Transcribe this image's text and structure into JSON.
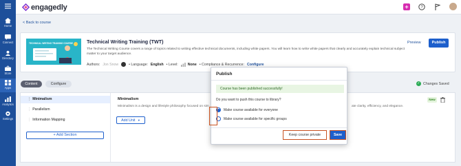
{
  "app": {
    "name": "engagedly",
    "brand_color": "#1d4f9a",
    "accent_color": "#1d5fcc"
  },
  "rail": {
    "items": [
      {
        "label": "Home",
        "icon": "home-icon"
      },
      {
        "label": "Connect",
        "icon": "connect-icon"
      },
      {
        "label": "Directory",
        "icon": "directory-icon"
      },
      {
        "label": "Store",
        "icon": "store-icon"
      },
      {
        "label": "Apps",
        "icon": "apps-icon"
      },
      {
        "label": "Analytics",
        "icon": "analytics-icon"
      },
      {
        "label": "Settings",
        "icon": "settings-icon"
      }
    ]
  },
  "nav": {
    "back_label": "< Back to course"
  },
  "course": {
    "thumbnail_text": "TECHNICAL WRITING TRAINING COURSE",
    "title": "Technical Writing Training (TWT)",
    "description": "The Technical Writing Course covers a range of topics related to writing effective technical documents, including white papers. You will learn how to write white papers that clearly and accurately explain technical subject matter to your target audience.",
    "authors_label": "Authors:",
    "author_name": "Jon Snow",
    "language_label": "• Language:",
    "language_value": "English",
    "level_label": "• Level:",
    "level_value": "None",
    "compliance_label": "• Compliance & Recurrence:",
    "compliance_value": "Configure",
    "preview_label": "Preview",
    "publish_label": "Publish"
  },
  "tabs": {
    "content": "Content",
    "configure": "Configure"
  },
  "status": {
    "saved_label": "Changes Saved"
  },
  "sections": {
    "items": [
      "Minimalism",
      "Parallelism",
      "Information Mapping"
    ],
    "add_label": "+ Add Section"
  },
  "unit": {
    "title": "Minimalism",
    "description_start": "Minimalism is a design and lifestyle philosophy focused on sim",
    "description_end": "ate clarity, efficiency, and elegance.",
    "badge": "New",
    "add_unit_label": "Add Unit"
  },
  "modal": {
    "title": "Publish",
    "success_message": "Course has been published successfully!",
    "question": "Do you want to push this course to library?",
    "options": [
      {
        "label": "Make course available for everyone",
        "selected": true
      },
      {
        "label": "Make course available for specific groups",
        "selected": false
      }
    ],
    "keep_private_label": "Keep course private",
    "save_label": "Save"
  }
}
